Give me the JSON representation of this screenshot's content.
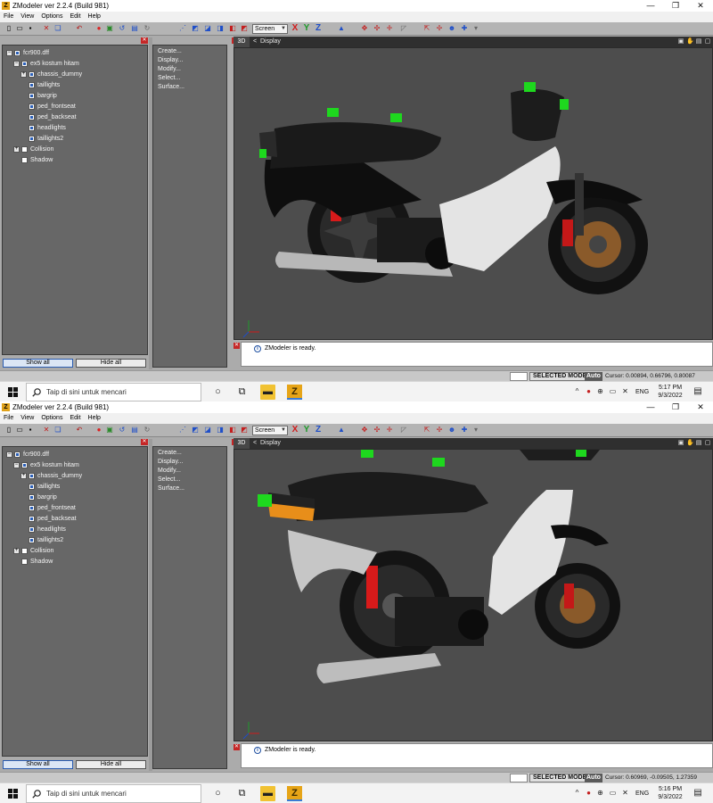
{
  "app": {
    "title": "ZModeler ver 2.2.4 (Build 981)",
    "icon_letter": "Z",
    "window_buttons": {
      "minimize": "—",
      "maximize": "❐",
      "close": "✕"
    }
  },
  "menu": {
    "items": [
      "File",
      "View",
      "Options",
      "Edit",
      "Help"
    ]
  },
  "toolbar": {
    "view_mode": "Screen",
    "axes": {
      "x": "X",
      "y": "Y",
      "z": "Z"
    },
    "colors": {
      "x": "#d01c1c",
      "y": "#1e9a2a",
      "z": "#1f4fc8"
    }
  },
  "tree": {
    "items": [
      {
        "label": "fcr900.dff",
        "expander": "−",
        "checked": true
      },
      {
        "label": "ex5 kostum hitam",
        "expander": "−",
        "checked": true
      },
      {
        "label": "chassis_dummy",
        "expander": "+",
        "checked": true
      },
      {
        "label": "taillights",
        "expander": "",
        "checked": true
      },
      {
        "label": "bargrip",
        "expander": "",
        "checked": true
      },
      {
        "label": "ped_frontseat",
        "expander": "",
        "checked": true
      },
      {
        "label": "ped_backseat",
        "expander": "",
        "checked": true
      },
      {
        "label": "headlights",
        "expander": "",
        "checked": true
      },
      {
        "label": "taillights2",
        "expander": "",
        "checked": true
      },
      {
        "label": "Collision",
        "expander": "+",
        "checked": false
      },
      {
        "label": "Shadow",
        "expander": "",
        "checked": false
      }
    ],
    "show_all": "Show all",
    "hide_all": "Hide all"
  },
  "commands": {
    "items": [
      "Create...",
      "Display...",
      "Modify...",
      "Select...",
      "Surface..."
    ]
  },
  "viewport": {
    "mode_label": "3D",
    "title": "Display",
    "back_arrow": "<"
  },
  "log": {
    "message": "ZModeler is ready."
  },
  "status": {
    "mode": "SELECTED MODE",
    "auto": "Auto"
  },
  "taskbar": {
    "search_placeholder": "Taip di sini untuk mencari",
    "language": "ENG"
  },
  "screens": [
    {
      "cursor": "Cursor: 0.00894, 0.66796, 0.80087",
      "time": "5:17 PM",
      "date": "9/3/2022"
    },
    {
      "cursor": "Cursor: 0.60969, -0.09505, 1.27359",
      "time": "5:16 PM",
      "date": "9/3/2022"
    }
  ]
}
